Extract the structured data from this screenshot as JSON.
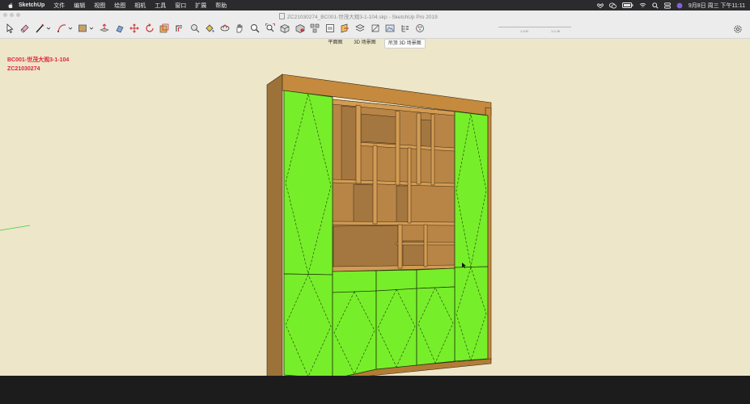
{
  "menubar": {
    "app_name": "SketchUp",
    "items": [
      "文件",
      "编辑",
      "视图",
      "绘图",
      "相机",
      "工具",
      "窗口",
      "扩展",
      "帮助"
    ],
    "datetime": "9月8日 周三 下午11:11"
  },
  "window": {
    "title": "ZC21030274_BC001-世茂大观3-1-104.skp - SketchUp Pro 2019"
  },
  "toolbar": {
    "tools": [
      "select-tool",
      "eraser-tool",
      "line-tool",
      "arc-tool",
      "rectangle-tool",
      "push-pull-tool",
      "follow-me-tool",
      "move-tool",
      "rotate-tool",
      "scale-tool",
      "offset-tool",
      "tape-measure-tool",
      "paint-bucket-tool",
      "orbit-tool",
      "pan-tool",
      "zoom-tool",
      "zoom-extents-tool",
      "warehouse-tool",
      "extension-tool",
      "component-tool",
      "layout-tool",
      "section-plane-tool",
      "section-display-tool",
      "styles-tool",
      "scenes-tool",
      "outliner-tool",
      "materials-tool"
    ],
    "slider_left_label": "1:100",
    "slider_right_label": "1:2.36"
  },
  "scenes": {
    "tabs": [
      "平面图",
      "3D 场景图",
      "吊顶 3D 场景图"
    ],
    "active_index": 2
  },
  "viewport": {
    "info_line_1": "BC001-世茂大观3-1-104",
    "info_line_2": "ZC21030274",
    "colors": {
      "background": "#ede6c9",
      "door_panel": "#77ee2a",
      "wood_frame": "#c2873e",
      "interior_shelf": "#a2773f",
      "ground": "#1c1c1c"
    }
  }
}
